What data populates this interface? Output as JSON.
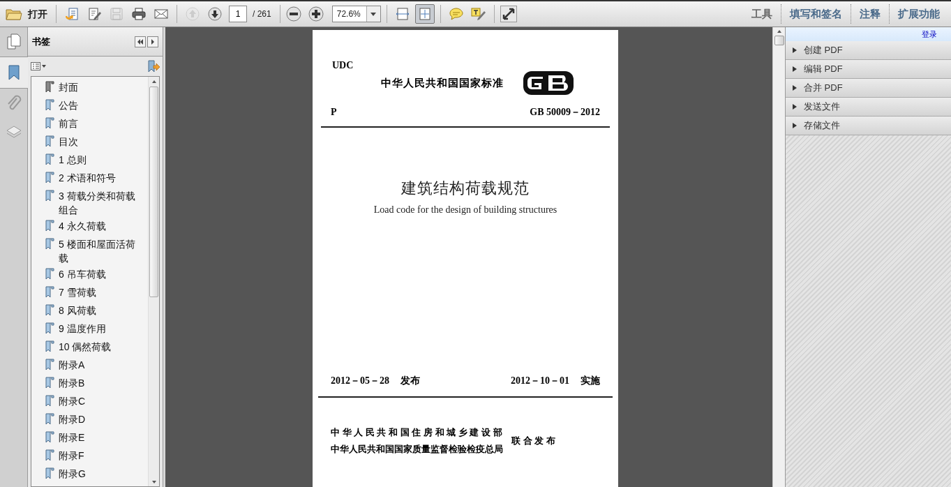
{
  "toolbar": {
    "open_label": "打开",
    "buttons": [
      {
        "kind": "create",
        "disabled": false
      },
      {
        "kind": "edit",
        "disabled": false
      },
      {
        "kind": "save",
        "disabled": true
      },
      {
        "kind": "print",
        "disabled": false
      },
      {
        "kind": "mail",
        "disabled": false
      }
    ],
    "nav_buttons": [
      {
        "kind": "up",
        "disabled": true
      },
      {
        "kind": "down",
        "disabled": false
      }
    ],
    "page_number": "1",
    "page_total": "/ 261",
    "zoom": "72.6%",
    "view_buttons": [
      {
        "kind": "fit-width",
        "selected": false
      },
      {
        "kind": "fit-page",
        "selected": true
      }
    ],
    "tabs": [
      "工具",
      "填写和签名",
      "注释",
      "扩展功能"
    ]
  },
  "rail": [
    {
      "kind": "pages",
      "selected": false
    },
    {
      "kind": "bookmarks",
      "selected": true
    },
    {
      "kind": "attachments",
      "selected": false
    },
    {
      "kind": "layers",
      "selected": false
    }
  ],
  "bookmarks": {
    "title": "书签",
    "items": [
      {
        "label": "封面",
        "selected": true
      },
      {
        "label": "公告",
        "selected": false
      },
      {
        "label": "前言",
        "selected": false
      },
      {
        "label": "目次",
        "selected": false
      },
      {
        "label": "1 总则",
        "selected": false
      },
      {
        "label": "2 术语和符号",
        "selected": false
      },
      {
        "label": "3 荷载分类和荷载组合",
        "selected": false
      },
      {
        "label": "4 永久荷载",
        "selected": false
      },
      {
        "label": "5 楼面和屋面活荷载",
        "selected": false
      },
      {
        "label": "6 吊车荷载",
        "selected": false
      },
      {
        "label": "7 雪荷载",
        "selected": false
      },
      {
        "label": "8 风荷载",
        "selected": false
      },
      {
        "label": "9 温度作用",
        "selected": false
      },
      {
        "label": "10 偶然荷载",
        "selected": false
      },
      {
        "label": "附录A",
        "selected": false
      },
      {
        "label": "附录B",
        "selected": false
      },
      {
        "label": "附录C",
        "selected": false
      },
      {
        "label": "附录D",
        "selected": false
      },
      {
        "label": "附录E",
        "selected": false
      },
      {
        "label": "附录F",
        "selected": false
      },
      {
        "label": "附录G",
        "selected": false
      }
    ]
  },
  "document": {
    "udc": "UDC",
    "national_standard": "中华人民共和国国家标准",
    "category": "P",
    "code": "GB 50009－2012",
    "title": "建筑结构荷载规范",
    "subtitle": "Load code for the design of building structures",
    "issued_date": "2012－05－28",
    "issued_label": "发布",
    "effective_date": "2012－10－01",
    "effective_label": "实施",
    "issuers": [
      "中 华 人 民 共 和 国 住 房 和 城 乡 建 设 部",
      "中华人民共和国国家质量监督检验检疫总局"
    ],
    "joint_label": "联 合 发 布"
  },
  "right_panel": {
    "login": "登录",
    "sections": [
      "创建 PDF",
      "编辑 PDF",
      "合并 PDF",
      "发送文件",
      "存储文件"
    ]
  }
}
